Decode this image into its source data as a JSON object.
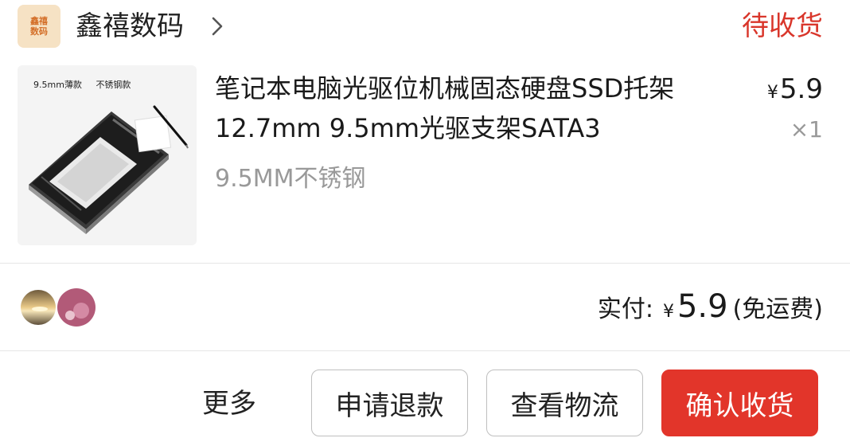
{
  "shop": {
    "logo_text_top": "鑫禧",
    "logo_text_bottom": "数码",
    "name": "鑫禧数码",
    "chevron_icon": "chevron-right-icon"
  },
  "order": {
    "status": "待收货"
  },
  "product": {
    "image_caption_left": "9.5mm薄款",
    "image_caption_right": "不锈钢款",
    "title": "笔记本电脑光驱位机械固态硬盘SSD托架12.7mm 9.5mm光驱支架SATA3",
    "sku": "9.5MM不锈钢",
    "currency": "¥",
    "unit_price": "5.9",
    "quantity": "×1"
  },
  "payment": {
    "label": "实付:",
    "currency": "¥",
    "amount": "5.9",
    "note": "(免运费)"
  },
  "actions": {
    "more": "更多",
    "refund": "申请退款",
    "logistics": "查看物流",
    "confirm": "确认收货"
  },
  "colors": {
    "accent_red": "#e2352a",
    "status_red": "#d9362b"
  }
}
